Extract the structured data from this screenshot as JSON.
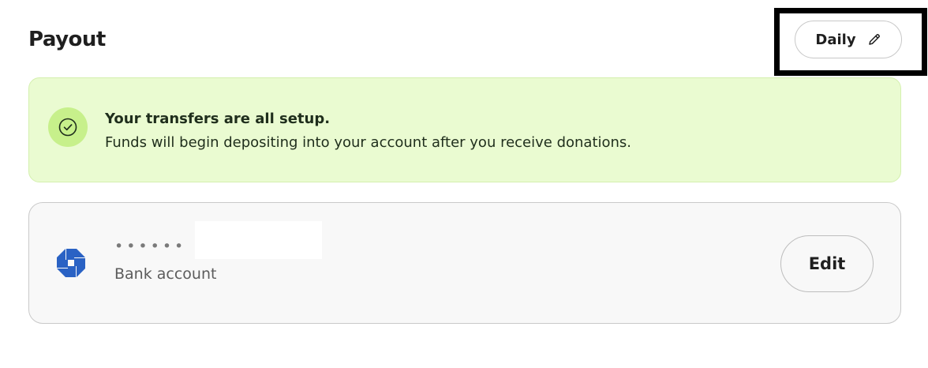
{
  "header": {
    "title": "Payout",
    "frequency_label": "Daily",
    "frequency_icon": "pencil-icon"
  },
  "alert": {
    "icon": "check-circle-icon",
    "title": "Your transfers are all setup.",
    "message": "Funds will begin depositing into your account after you receive donations.",
    "background": "#eafbd1",
    "icon_background": "#c7f08b"
  },
  "bank": {
    "logo": "bank-logo-icon",
    "masked_number": "••••••",
    "account_type": "Bank account",
    "edit_label": "Edit",
    "logo_color": "#2a62c4"
  }
}
